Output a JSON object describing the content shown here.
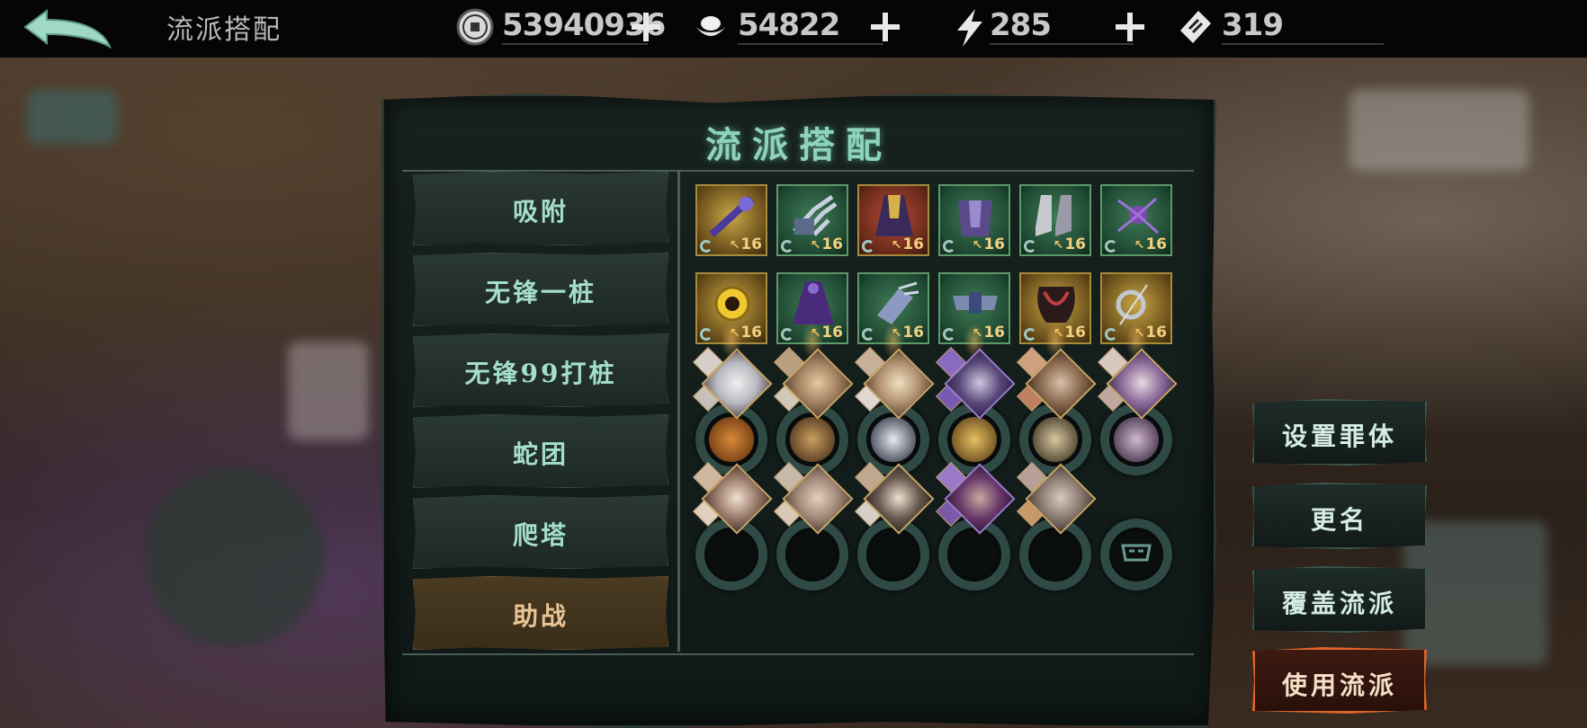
{
  "header": {
    "title": "流派搭配",
    "back_icon": "back-arrow-icon",
    "resources": [
      {
        "name": "copper-coin",
        "icon": "coin-icon",
        "value": "53940936"
      },
      {
        "name": "silver-ingot",
        "icon": "ingot-icon",
        "value": "54822"
      },
      {
        "name": "stamina",
        "icon": "lightning-icon",
        "value": "285"
      },
      {
        "name": "ticket",
        "icon": "ticket-icon",
        "value": "319"
      }
    ]
  },
  "panel": {
    "title": "流派搭配",
    "tabs": [
      {
        "label": "吸附",
        "active": false
      },
      {
        "label": "无锋一桩",
        "active": false
      },
      {
        "label": "无锋99打桩",
        "active": false
      },
      {
        "label": "蛇团",
        "active": false
      },
      {
        "label": "爬塔",
        "active": false
      },
      {
        "label": "助战",
        "active": true
      }
    ],
    "equipment_row1": [
      {
        "level": "16",
        "rarity": "gold",
        "icon": "staff-icon"
      },
      {
        "level": "16",
        "rarity": "green",
        "icon": "claw-gauntlet-icon"
      },
      {
        "level": "16",
        "rarity": "red",
        "icon": "robe-icon"
      },
      {
        "level": "16",
        "rarity": "green",
        "icon": "armor-icon"
      },
      {
        "level": "16",
        "rarity": "green",
        "icon": "boots-icon"
      },
      {
        "level": "16",
        "rarity": "green",
        "icon": "spider-icon"
      }
    ],
    "equipment_row2": [
      {
        "level": "16",
        "rarity": "gold",
        "icon": "sun-charm-icon"
      },
      {
        "level": "16",
        "rarity": "green",
        "icon": "cloak-icon"
      },
      {
        "level": "16",
        "rarity": "green",
        "icon": "gauntlet-icon"
      },
      {
        "level": "16",
        "rarity": "green",
        "icon": "belt-icon"
      },
      {
        "level": "16",
        "rarity": "gold",
        "icon": "mask-icon"
      },
      {
        "level": "16",
        "rarity": "gold",
        "icon": "ring-icon"
      }
    ],
    "team_row1": [
      "character-slot-1",
      "character-slot-2",
      "character-slot-3",
      "character-slot-4",
      "character-slot-5",
      "character-slot-6"
    ],
    "team_row2": [
      "character-slot-7",
      "character-slot-8",
      "character-slot-9",
      "character-slot-10",
      "character-slot-11"
    ],
    "empty_slot_icon": "mask-outline-icon"
  },
  "actions": {
    "set_body": "设置罪体",
    "rename": "更名",
    "overwrite": "覆盖流派",
    "use": "使用流派"
  },
  "colors": {
    "accent_green": "#8fd3bb",
    "active_tab": "#e9c596",
    "primary_button_border": "#e0642a"
  }
}
